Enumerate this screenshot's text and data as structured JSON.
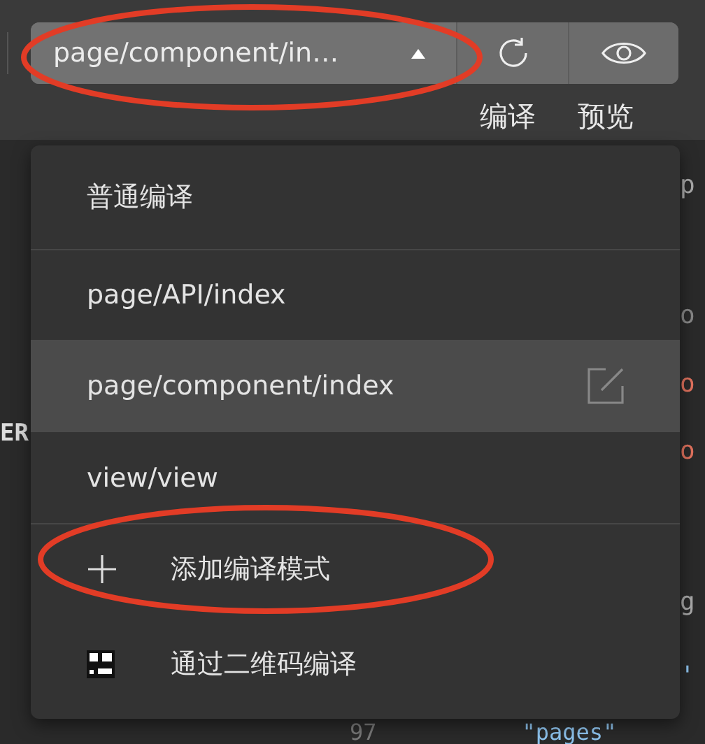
{
  "toolbar": {
    "mode_selector": {
      "label": "page/component/in…"
    },
    "button_labels": [
      "编译",
      "预览"
    ]
  },
  "menu": {
    "groups": [
      {
        "items": [
          {
            "kind": "mode",
            "label": "普通编译",
            "selected": false
          }
        ]
      },
      {
        "items": [
          {
            "kind": "mode",
            "label": "page/API/index",
            "selected": false
          },
          {
            "kind": "mode",
            "label": "page/component/index",
            "selected": true
          },
          {
            "kind": "mode",
            "label": "view/view",
            "selected": false
          }
        ]
      },
      {
        "items": [
          {
            "kind": "add",
            "label": "添加编译模式",
            "selected": false
          },
          {
            "kind": "qrcode",
            "label": "通过二维码编译",
            "selected": false
          }
        ]
      }
    ]
  },
  "editor": {
    "left_fragment": "ER",
    "right_fragments": [
      "p",
      "o",
      "o",
      "o",
      "g",
      "'"
    ],
    "line_number": "97",
    "code_fragment": "\"pages\""
  }
}
